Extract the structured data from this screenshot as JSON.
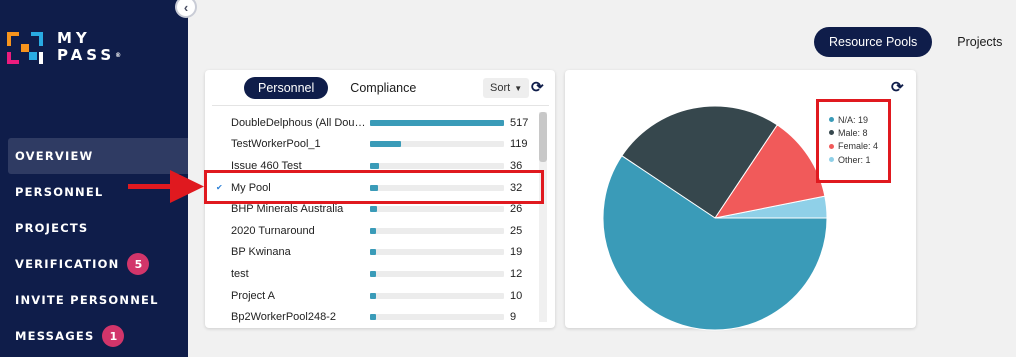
{
  "sidebar": {
    "logo_line1": "MY",
    "logo_line2": "PASS",
    "logo_mark": "®",
    "items": [
      {
        "label": "OVERVIEW",
        "active": true
      },
      {
        "label": "PERSONNEL"
      },
      {
        "label": "PROJECTS"
      },
      {
        "label": "VERIFICATION",
        "badge": "5"
      },
      {
        "label": "INVITE PERSONNEL"
      },
      {
        "label": "MESSAGES",
        "badge": "1"
      }
    ]
  },
  "top_tabs": [
    {
      "label": "Resource Pools",
      "active": true
    },
    {
      "label": "Projects"
    }
  ],
  "personnel_card": {
    "tabs": [
      {
        "label": "Personnel",
        "active": true
      },
      {
        "label": "Compliance"
      }
    ],
    "sort_label": "Sort",
    "max_value": 517,
    "rows": [
      {
        "name": "DoubleDelphous (All Dou…",
        "value": 517
      },
      {
        "name": "TestWorkerPool_1",
        "value": 119
      },
      {
        "name": "Issue 460 Test",
        "value": 36
      },
      {
        "name": "My Pool",
        "value": 32,
        "selected": true
      },
      {
        "name": "BHP Minerals Australia",
        "value": 26
      },
      {
        "name": "2020 Turnaround",
        "value": 25
      },
      {
        "name": "BP Kwinana",
        "value": 19
      },
      {
        "name": "test",
        "value": 12
      },
      {
        "name": "Project A",
        "value": 10
      },
      {
        "name": "Bp2WorkerPool248-2",
        "value": 9
      }
    ]
  },
  "chart_data": {
    "type": "pie",
    "legend_position": "top-right",
    "slices": [
      {
        "label": "N/A",
        "value": 19,
        "color": "#3a9bb8"
      },
      {
        "label": "Male",
        "value": 8,
        "color": "#36474d"
      },
      {
        "label": "Female",
        "value": 4,
        "color": "#f15a5a"
      },
      {
        "label": "Other",
        "value": 1,
        "color": "#8fd0e8"
      }
    ],
    "legend": [
      "N/A: 19",
      "Male: 8",
      "Female: 4",
      "Other: 1"
    ]
  },
  "colors": {
    "sidebar_bg": "#0f1d4a",
    "accent": "#3a9bb8",
    "highlight": "#e0191f",
    "badge": "#d2356a"
  },
  "icons": {
    "collapse": "chevron-left-icon",
    "refresh": "refresh-icon",
    "check": "check-icon"
  }
}
